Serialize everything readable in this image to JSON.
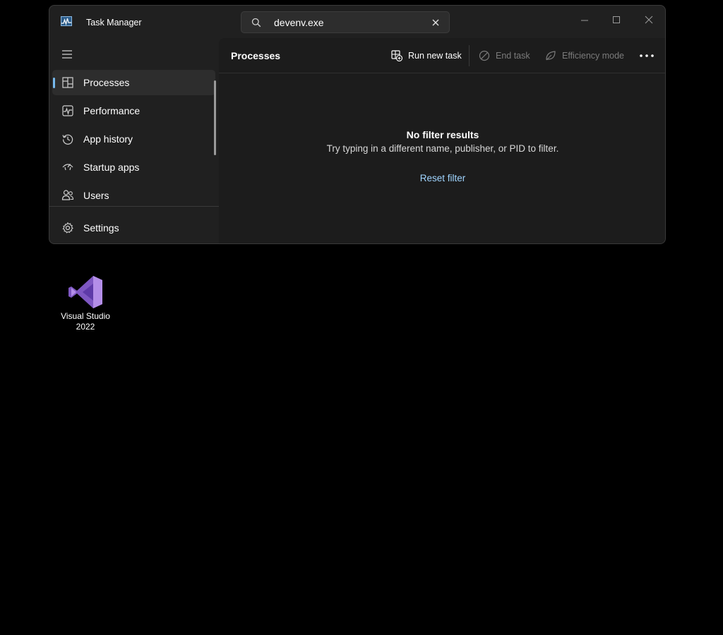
{
  "window": {
    "title": "Task Manager",
    "search": {
      "value": "devenv.exe"
    }
  },
  "sidebar": {
    "items": [
      {
        "label": "Processes",
        "icon": "processes-icon",
        "active": true
      },
      {
        "label": "Performance",
        "icon": "performance-icon"
      },
      {
        "label": "App history",
        "icon": "app-history-icon"
      },
      {
        "label": "Startup apps",
        "icon": "startup-apps-icon"
      },
      {
        "label": "Users",
        "icon": "users-icon"
      }
    ],
    "settings_label": "Settings"
  },
  "main": {
    "title": "Processes",
    "toolbar": {
      "run_new_task": "Run new task",
      "end_task": "End task",
      "efficiency_mode": "Efficiency mode"
    },
    "empty": {
      "title": "No filter results",
      "subtitle": "Try typing in a different name, publisher, or PID to filter.",
      "reset": "Reset filter"
    }
  },
  "desktop": {
    "icon_label_line1": "Visual Studio",
    "icon_label_line2": "2022"
  },
  "colors": {
    "accent": "#76b9ed",
    "link": "#9fd4ff",
    "vs_purple": "#a77cdb"
  }
}
